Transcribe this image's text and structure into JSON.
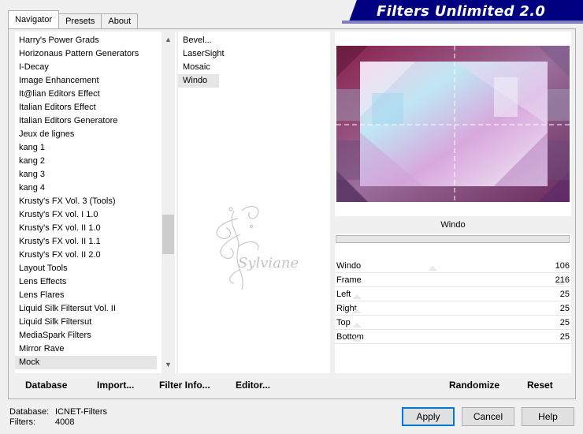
{
  "tabs": [
    {
      "label": "Navigator",
      "active": true
    },
    {
      "label": "Presets",
      "active": false
    },
    {
      "label": "About",
      "active": false
    }
  ],
  "app_title": "Filters Unlimited 2.0",
  "categories": [
    "Harry's Power Grads",
    "Horizonaus Pattern Generators",
    "I-Decay",
    "Image Enhancement",
    "It@lian Editors Effect",
    "Italian Editors Effect",
    "Italian Editors Generatore",
    "Jeux de lignes",
    "kang 1",
    "kang 2",
    "kang 3",
    "kang 4",
    "Krusty's FX Vol. 3 (Tools)",
    "Krusty's FX vol. I 1.0",
    "Krusty's FX vol. II 1.0",
    "Krusty's FX vol. II 1.1",
    "Krusty's FX vol. II 2.0",
    "Layout Tools",
    "Lens Effects",
    "Lens Flares",
    "Liquid Silk Filtersut Vol. II",
    "Liquid Silk Filtersut",
    "MediaSpark Filters",
    "Mirror Rave",
    "Mock"
  ],
  "selected_category": "Mock",
  "filters": [
    "Bevel...",
    "LaserSight",
    "Mosaic",
    "Windo"
  ],
  "selected_filter": "Windo",
  "watermark_text": "Sylviane",
  "current_filter_name": "Windo",
  "parameters": [
    {
      "label": "Windo",
      "value": "106"
    },
    {
      "label": "Frame",
      "value": "216"
    },
    {
      "label": "Left",
      "value": "25"
    },
    {
      "label": "Right",
      "value": "25"
    },
    {
      "label": "Top",
      "value": "25"
    },
    {
      "label": "Bottom",
      "value": "25"
    }
  ],
  "bottom_links": {
    "database": "Database",
    "import": "Import...",
    "filter_info": "Filter Info...",
    "editor": "Editor...",
    "randomize": "Randomize",
    "reset": "Reset"
  },
  "status": {
    "database_label": "Database:",
    "database_value": "ICNET-Filters",
    "filters_label": "Filters:",
    "filters_value": "4008"
  },
  "buttons": {
    "apply": "Apply",
    "cancel": "Cancel",
    "help": "Help"
  },
  "colors": {
    "banner": "#000080",
    "default_button_border": "#0078d7",
    "selection": "#e6e6e6"
  }
}
